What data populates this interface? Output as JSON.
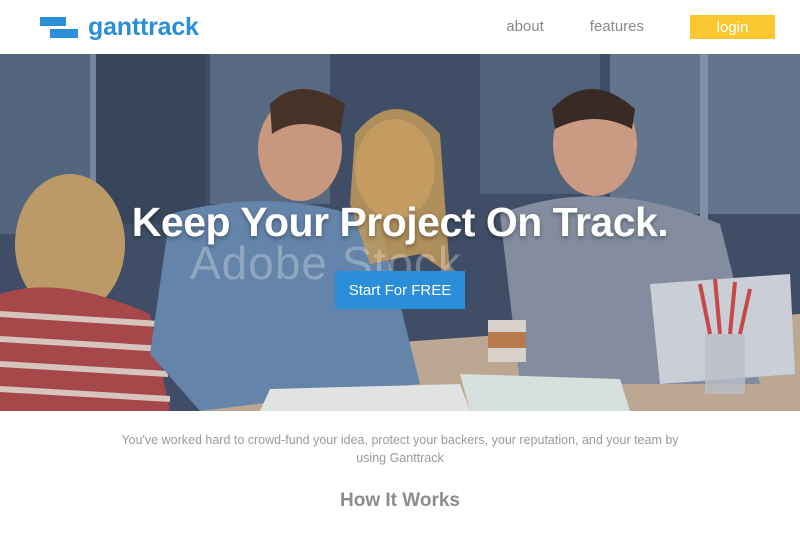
{
  "brand": {
    "name": "ganttrack",
    "color": "#2a8fd8"
  },
  "nav": {
    "links": [
      "about",
      "features"
    ],
    "login_label": "login",
    "login_color": "#fbc731"
  },
  "hero": {
    "title": "Keep Your Project On Track.",
    "watermark": "Adobe Stock",
    "cta_label": "Start For FREE",
    "cta_color": "#2a8fd8"
  },
  "tagline": "You've worked hard to crowd-fund your idea, protect your backers, your reputation, and your team by using Ganttrack",
  "section": {
    "title": "How It Works"
  }
}
